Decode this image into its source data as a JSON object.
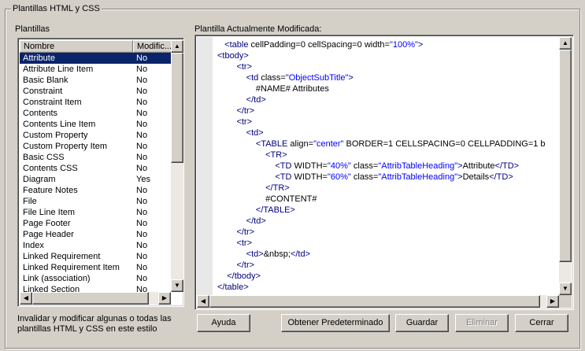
{
  "group_title": "Plantillas HTML y CSS",
  "templates_label": "Plantillas",
  "editor_label": "Plantilla Actualmente Modificada:",
  "list": {
    "columns": [
      "Nombre",
      "Modific..."
    ],
    "rows": [
      {
        "name": "Attribute",
        "modified": "No",
        "selected": true
      },
      {
        "name": "Attribute Line Item",
        "modified": "No"
      },
      {
        "name": "Basic Blank",
        "modified": "No"
      },
      {
        "name": "Constraint",
        "modified": "No"
      },
      {
        "name": "Constraint Item",
        "modified": "No"
      },
      {
        "name": "Contents",
        "modified": "No"
      },
      {
        "name": "Contents Line Item",
        "modified": "No"
      },
      {
        "name": "Custom Property",
        "modified": "No"
      },
      {
        "name": "Custom Property Item",
        "modified": "No"
      },
      {
        "name": "Basic CSS",
        "modified": "No"
      },
      {
        "name": "Contents CSS",
        "modified": "No"
      },
      {
        "name": "Diagram",
        "modified": "Yes"
      },
      {
        "name": "Feature Notes",
        "modified": "No"
      },
      {
        "name": "File",
        "modified": "No"
      },
      {
        "name": "File Line Item",
        "modified": "No"
      },
      {
        "name": "Page Footer",
        "modified": "No"
      },
      {
        "name": "Page Header",
        "modified": "No"
      },
      {
        "name": "Index",
        "modified": "No"
      },
      {
        "name": "Linked Requirement",
        "modified": "No"
      },
      {
        "name": "Linked Requirement Item",
        "modified": "No"
      },
      {
        "name": "Link (association)",
        "modified": "No"
      },
      {
        "name": "Linked Section",
        "modified": "No"
      }
    ]
  },
  "code_lines": [
    [
      [
        "tag",
        "   <table "
      ],
      [
        "attr",
        "cellPadding=0 cellSpacing=0 width="
      ],
      [
        "val",
        "\"100%\""
      ],
      [
        "tag",
        ">"
      ]
    ],
    [
      [
        "tag",
        "<tbody>"
      ]
    ],
    [
      [
        "tag",
        "        <tr>"
      ]
    ],
    [
      [
        "tag",
        "            <td "
      ],
      [
        "attr",
        "class="
      ],
      [
        "val",
        "\"ObjectSubTitle\""
      ],
      [
        "tag",
        ">"
      ]
    ],
    [
      [
        "txt",
        "                #NAME# Attributes"
      ]
    ],
    [
      [
        "tag",
        "            </td>"
      ]
    ],
    [
      [
        "tag",
        "        </tr>"
      ]
    ],
    [
      [
        "tag",
        "        <tr>"
      ]
    ],
    [
      [
        "tag",
        "            <td>"
      ]
    ],
    [
      [
        "tag",
        "                <TABLE "
      ],
      [
        "attr",
        "align="
      ],
      [
        "val",
        "\"center\""
      ],
      [
        "attr",
        " BORDER=1 CELLSPACING=0 CELLPADDING=1 b"
      ]
    ],
    [
      [
        "tag",
        "                    <TR>"
      ]
    ],
    [
      [
        "tag",
        "                        <TD "
      ],
      [
        "attr",
        "WIDTH="
      ],
      [
        "val",
        "\"40%\""
      ],
      [
        "attr",
        " class="
      ],
      [
        "val",
        "\"AttribTableHeading\""
      ],
      [
        "tag",
        ">"
      ],
      [
        "txt",
        "Attribute"
      ],
      [
        "tag",
        "</TD>"
      ]
    ],
    [
      [
        "tag",
        "                        <TD "
      ],
      [
        "attr",
        "WIDTH="
      ],
      [
        "val",
        "\"60%\""
      ],
      [
        "attr",
        " class="
      ],
      [
        "val",
        "\"AttribTableHeading\""
      ],
      [
        "tag",
        ">"
      ],
      [
        "txt",
        "Details"
      ],
      [
        "tag",
        "</TD>"
      ]
    ],
    [
      [
        "tag",
        "                    </TR>"
      ]
    ],
    [
      [
        "txt",
        "                    #CONTENT#"
      ]
    ],
    [
      [
        "tag",
        "                </TABLE>"
      ]
    ],
    [
      [
        "tag",
        "            </td>"
      ]
    ],
    [
      [
        "tag",
        "        </tr>"
      ]
    ],
    [
      [
        "tag",
        "        <tr>"
      ]
    ],
    [
      [
        "tag",
        "            <td>"
      ],
      [
        "txt",
        "&nbsp;"
      ],
      [
        "tag",
        "</td>"
      ]
    ],
    [
      [
        "tag",
        "        </tr>"
      ]
    ],
    [
      [
        "tag",
        "    </tbody>"
      ]
    ],
    [
      [
        "tag",
        "</table>"
      ]
    ]
  ],
  "hint_text": "Invalidar y modificar algunas o todas las plantillas HTML y CSS en este estilo",
  "buttons": {
    "help": "Ayuda",
    "get_default": "Obtener Predeterminado",
    "save": "Guardar",
    "delete": "Eliminar",
    "close": "Cerrar"
  },
  "colors": {
    "tag": "#000080",
    "value": "#0000ff",
    "selection": "#0a246a",
    "window": "#d4d0c8"
  }
}
